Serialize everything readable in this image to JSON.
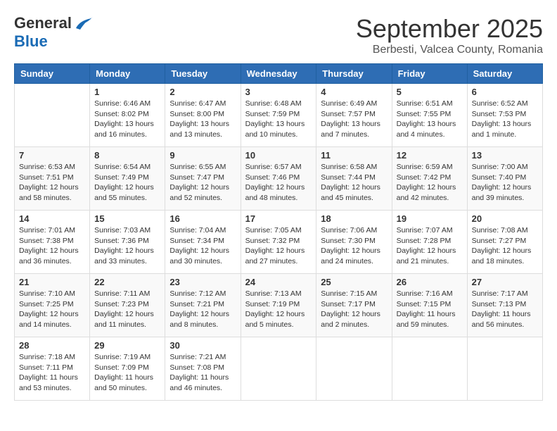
{
  "header": {
    "logo_general": "General",
    "logo_blue": "Blue",
    "month_title": "September 2025",
    "subtitle": "Berbesti, Valcea County, Romania"
  },
  "days_of_week": [
    "Sunday",
    "Monday",
    "Tuesday",
    "Wednesday",
    "Thursday",
    "Friday",
    "Saturday"
  ],
  "weeks": [
    [
      {
        "day": "",
        "info": ""
      },
      {
        "day": "1",
        "info": "Sunrise: 6:46 AM\nSunset: 8:02 PM\nDaylight: 13 hours\nand 16 minutes."
      },
      {
        "day": "2",
        "info": "Sunrise: 6:47 AM\nSunset: 8:00 PM\nDaylight: 13 hours\nand 13 minutes."
      },
      {
        "day": "3",
        "info": "Sunrise: 6:48 AM\nSunset: 7:59 PM\nDaylight: 13 hours\nand 10 minutes."
      },
      {
        "day": "4",
        "info": "Sunrise: 6:49 AM\nSunset: 7:57 PM\nDaylight: 13 hours\nand 7 minutes."
      },
      {
        "day": "5",
        "info": "Sunrise: 6:51 AM\nSunset: 7:55 PM\nDaylight: 13 hours\nand 4 minutes."
      },
      {
        "day": "6",
        "info": "Sunrise: 6:52 AM\nSunset: 7:53 PM\nDaylight: 13 hours\nand 1 minute."
      }
    ],
    [
      {
        "day": "7",
        "info": "Sunrise: 6:53 AM\nSunset: 7:51 PM\nDaylight: 12 hours\nand 58 minutes."
      },
      {
        "day": "8",
        "info": "Sunrise: 6:54 AM\nSunset: 7:49 PM\nDaylight: 12 hours\nand 55 minutes."
      },
      {
        "day": "9",
        "info": "Sunrise: 6:55 AM\nSunset: 7:47 PM\nDaylight: 12 hours\nand 52 minutes."
      },
      {
        "day": "10",
        "info": "Sunrise: 6:57 AM\nSunset: 7:46 PM\nDaylight: 12 hours\nand 48 minutes."
      },
      {
        "day": "11",
        "info": "Sunrise: 6:58 AM\nSunset: 7:44 PM\nDaylight: 12 hours\nand 45 minutes."
      },
      {
        "day": "12",
        "info": "Sunrise: 6:59 AM\nSunset: 7:42 PM\nDaylight: 12 hours\nand 42 minutes."
      },
      {
        "day": "13",
        "info": "Sunrise: 7:00 AM\nSunset: 7:40 PM\nDaylight: 12 hours\nand 39 minutes."
      }
    ],
    [
      {
        "day": "14",
        "info": "Sunrise: 7:01 AM\nSunset: 7:38 PM\nDaylight: 12 hours\nand 36 minutes."
      },
      {
        "day": "15",
        "info": "Sunrise: 7:03 AM\nSunset: 7:36 PM\nDaylight: 12 hours\nand 33 minutes."
      },
      {
        "day": "16",
        "info": "Sunrise: 7:04 AM\nSunset: 7:34 PM\nDaylight: 12 hours\nand 30 minutes."
      },
      {
        "day": "17",
        "info": "Sunrise: 7:05 AM\nSunset: 7:32 PM\nDaylight: 12 hours\nand 27 minutes."
      },
      {
        "day": "18",
        "info": "Sunrise: 7:06 AM\nSunset: 7:30 PM\nDaylight: 12 hours\nand 24 minutes."
      },
      {
        "day": "19",
        "info": "Sunrise: 7:07 AM\nSunset: 7:28 PM\nDaylight: 12 hours\nand 21 minutes."
      },
      {
        "day": "20",
        "info": "Sunrise: 7:08 AM\nSunset: 7:27 PM\nDaylight: 12 hours\nand 18 minutes."
      }
    ],
    [
      {
        "day": "21",
        "info": "Sunrise: 7:10 AM\nSunset: 7:25 PM\nDaylight: 12 hours\nand 14 minutes."
      },
      {
        "day": "22",
        "info": "Sunrise: 7:11 AM\nSunset: 7:23 PM\nDaylight: 12 hours\nand 11 minutes."
      },
      {
        "day": "23",
        "info": "Sunrise: 7:12 AM\nSunset: 7:21 PM\nDaylight: 12 hours\nand 8 minutes."
      },
      {
        "day": "24",
        "info": "Sunrise: 7:13 AM\nSunset: 7:19 PM\nDaylight: 12 hours\nand 5 minutes."
      },
      {
        "day": "25",
        "info": "Sunrise: 7:15 AM\nSunset: 7:17 PM\nDaylight: 12 hours\nand 2 minutes."
      },
      {
        "day": "26",
        "info": "Sunrise: 7:16 AM\nSunset: 7:15 PM\nDaylight: 11 hours\nand 59 minutes."
      },
      {
        "day": "27",
        "info": "Sunrise: 7:17 AM\nSunset: 7:13 PM\nDaylight: 11 hours\nand 56 minutes."
      }
    ],
    [
      {
        "day": "28",
        "info": "Sunrise: 7:18 AM\nSunset: 7:11 PM\nDaylight: 11 hours\nand 53 minutes."
      },
      {
        "day": "29",
        "info": "Sunrise: 7:19 AM\nSunset: 7:09 PM\nDaylight: 11 hours\nand 50 minutes."
      },
      {
        "day": "30",
        "info": "Sunrise: 7:21 AM\nSunset: 7:08 PM\nDaylight: 11 hours\nand 46 minutes."
      },
      {
        "day": "",
        "info": ""
      },
      {
        "day": "",
        "info": ""
      },
      {
        "day": "",
        "info": ""
      },
      {
        "day": "",
        "info": ""
      }
    ]
  ]
}
